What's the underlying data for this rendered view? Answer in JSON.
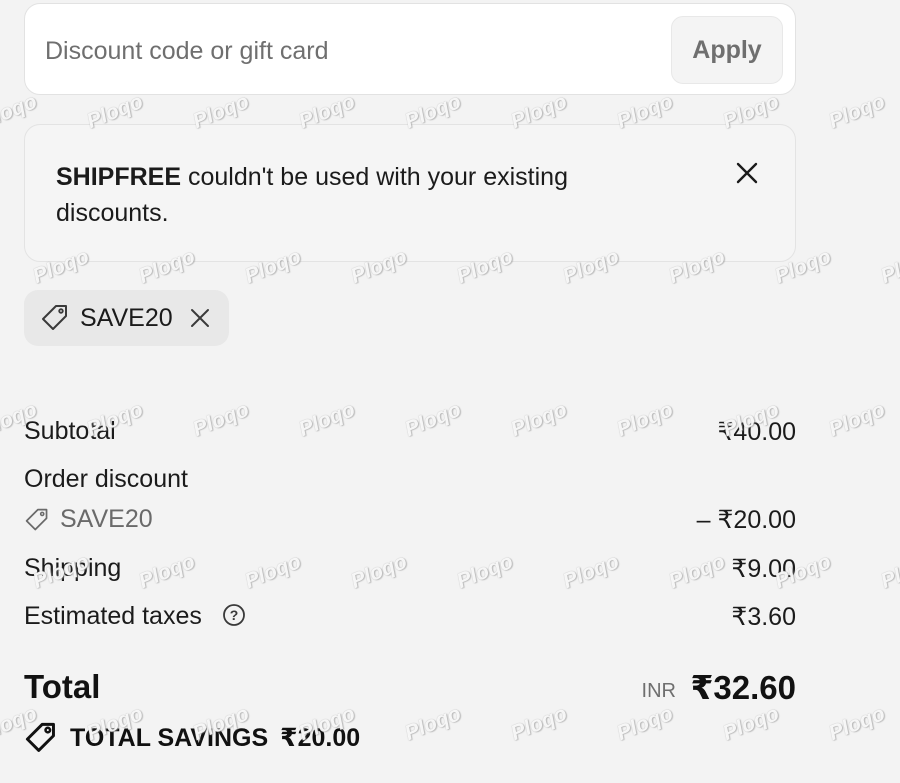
{
  "discount": {
    "placeholder": "Discount code or gift card",
    "apply_label": "Apply"
  },
  "alert": {
    "code": "SHIPFREE",
    "message": " couldn't be used with your existing discounts."
  },
  "applied_code": {
    "label": "SAVE20"
  },
  "summary": {
    "subtotal_label": "Subtotal",
    "subtotal_value": "₹40.00",
    "order_discount_label": "Order discount",
    "order_discount_code": "SAVE20",
    "order_discount_value": "– ₹20.00",
    "shipping_label": "Shipping",
    "shipping_value": "₹9.00",
    "taxes_label": "Estimated taxes",
    "taxes_value": "₹3.60"
  },
  "total": {
    "label": "Total",
    "currency": "INR",
    "value": "₹32.60",
    "savings_label": "TOTAL SAVINGS",
    "savings_value": "₹20.00"
  },
  "watermark": {
    "text": "Ploqo"
  },
  "colors": {
    "background": "#f3f3f3",
    "text": "#1b1b1b",
    "muted": "#6f6f6f"
  }
}
